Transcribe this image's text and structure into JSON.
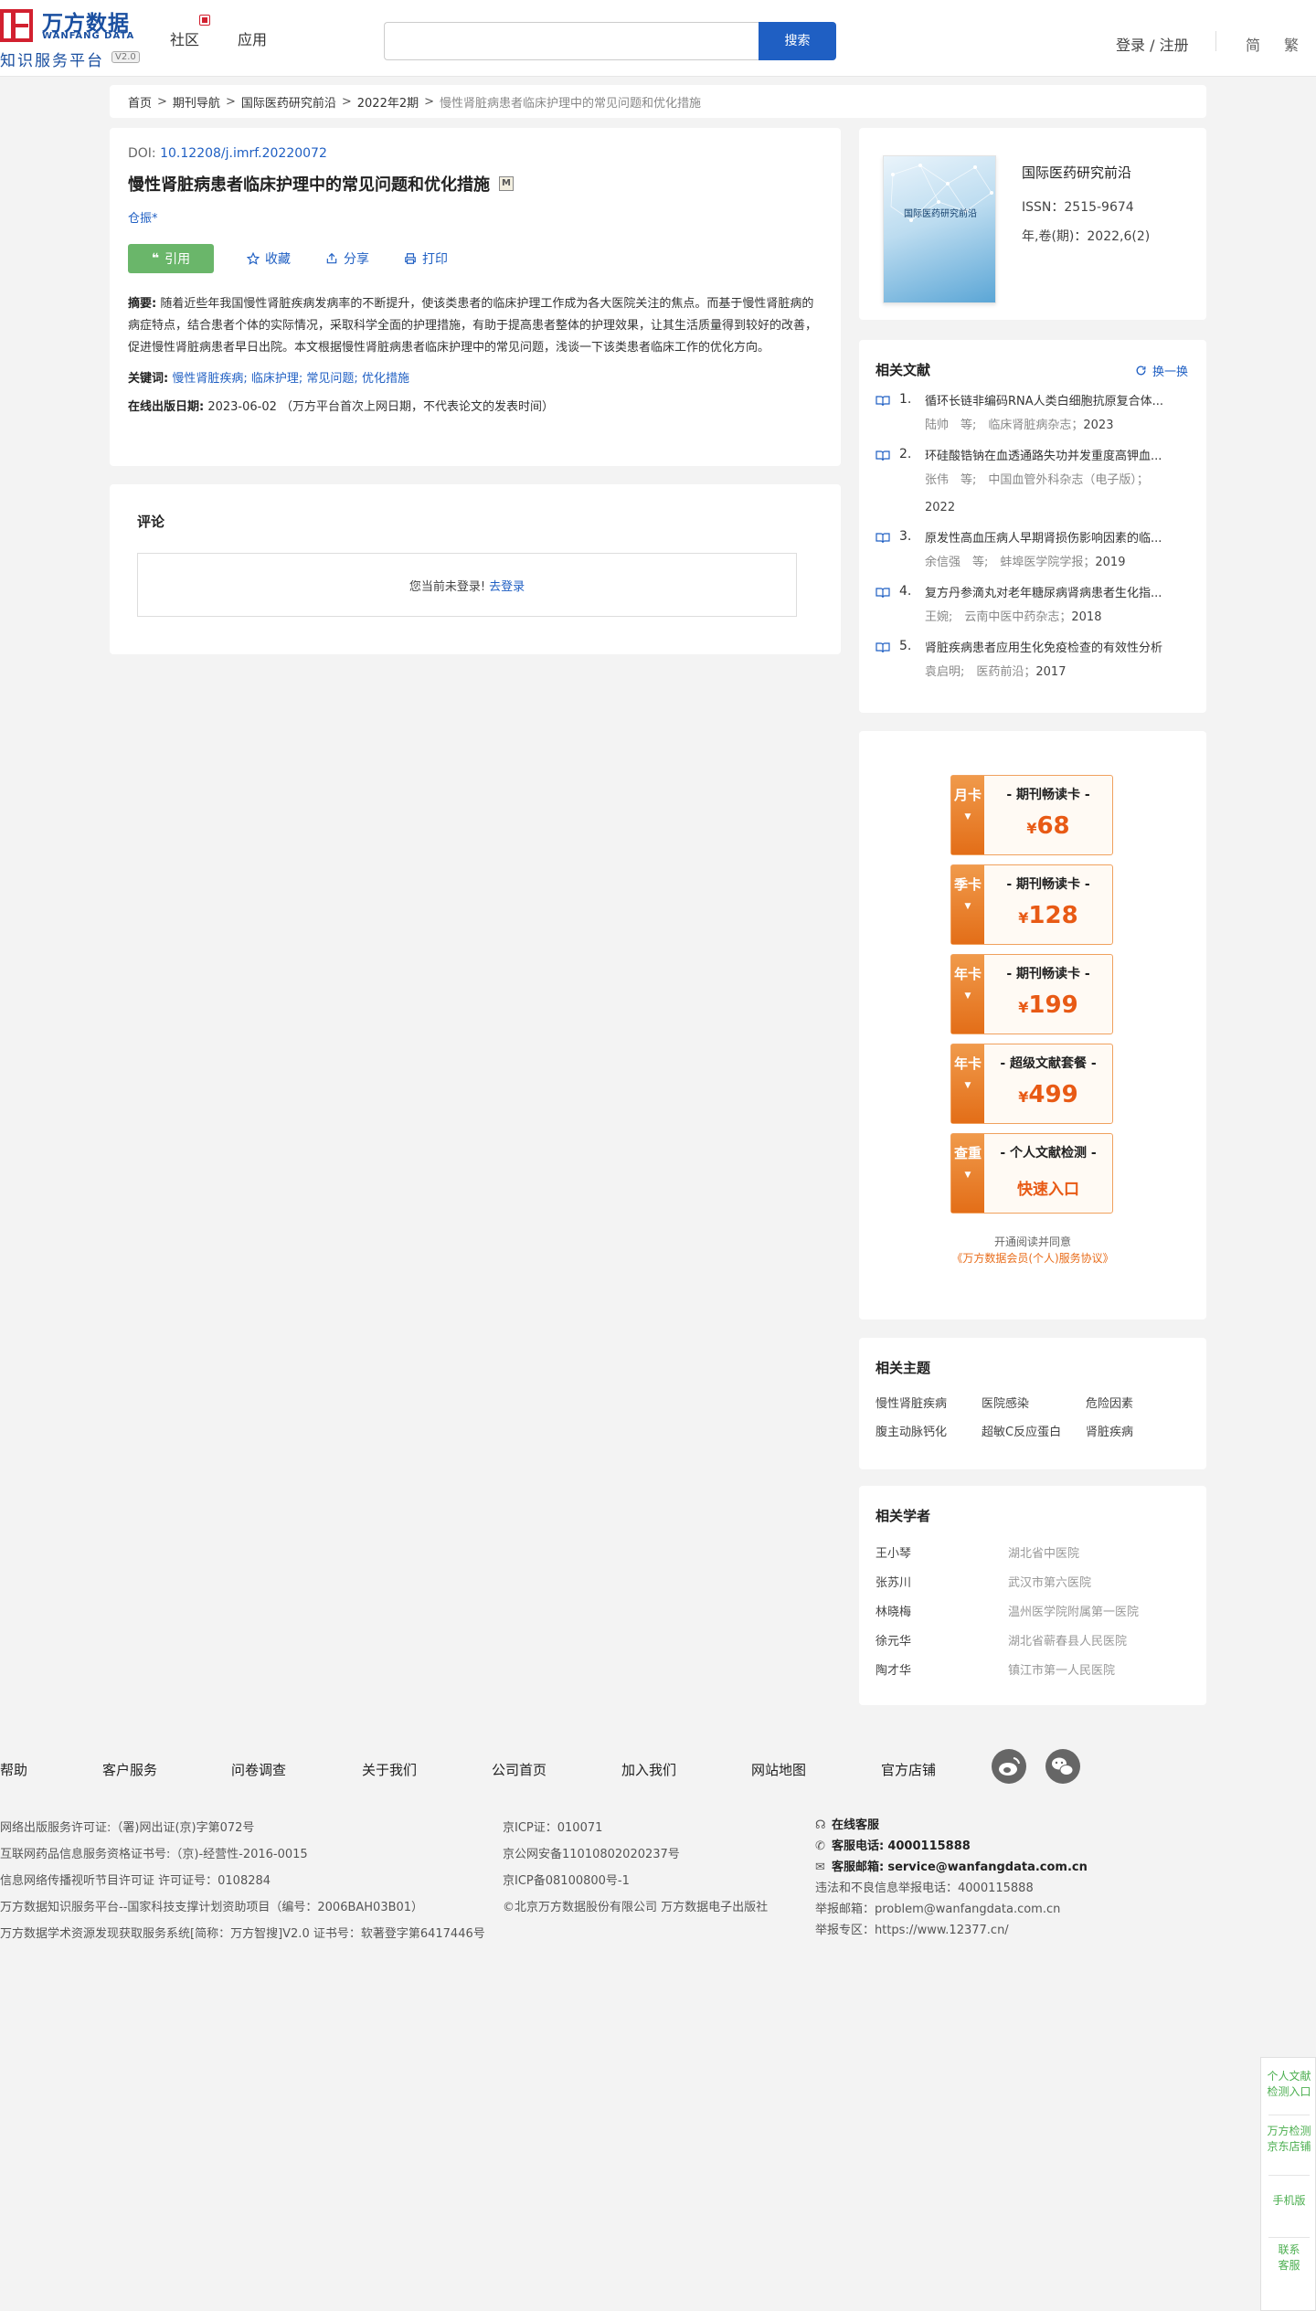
{
  "header": {
    "logo_cn": "万方数据",
    "logo_en": "WANFANG DATA",
    "logo_sub": "知识服务平台",
    "logo_version": "V2.0",
    "nav": [
      "社区",
      "应用"
    ],
    "search_button": "搜索",
    "search_placeholder": "",
    "login": "登录 / 注册",
    "lang_simplified": "简",
    "lang_traditional": "繁"
  },
  "breadcrumb": [
    "首页",
    "期刊导航",
    "国际医药研究前沿",
    "2022年2期",
    "慢性肾脏病患者临床护理中的常见问题和优化措施"
  ],
  "article": {
    "doi_label": "DOI: ",
    "doi": "10.12208/j.imrf.20220072",
    "title": "慢性肾脏病患者临床护理中的常见问题和优化措施",
    "badge": "M",
    "author": "仓振*",
    "actions": {
      "cite": "引用",
      "favorite": "收藏",
      "share": "分享",
      "print": "打印"
    },
    "abstract_label": "摘要:",
    "abstract": "随着近些年我国慢性肾脏疾病发病率的不断提升，使该类患者的临床护理工作成为各大医院关注的焦点。而基于慢性肾脏病的病症特点，结合患者个体的实际情况，采取科学全面的护理措施，有助于提高患者整体的护理效果，让其生活质量得到较好的改善，促进慢性肾脏病患者早日出院。本文根据慢性肾脏病患者临床护理中的常见问题，浅谈一下该类患者临床工作的优化方向。",
    "keywords_label": "关键词:",
    "keywords": [
      "慢性肾脏疾病",
      "临床护理",
      "常见问题",
      "优化措施"
    ],
    "pubdate_label": "在线出版日期:",
    "pubdate": "2023-06-02",
    "pubdate_note": "（万方平台首次上网日期，不代表论文的发表时间）"
  },
  "comments": {
    "title": "评论",
    "message": "您当前未登录!",
    "login_link": "去登录"
  },
  "journal": {
    "cover_title": "国际医药研究前沿",
    "name": "国际医药研究前沿",
    "issn": "ISSN：2515-9674",
    "year_issue": "年,卷(期)：2022,6(2)"
  },
  "related_docs": {
    "title": "相关文献",
    "refresh": "换一换",
    "items": [
      {
        "num": "1.",
        "title": "循环长链非编码RNA人类白细胞抗原复合体...",
        "meta": "陆帅　等;　临床肾脏病杂志；",
        "year": "2023"
      },
      {
        "num": "2.",
        "title": "环硅酸锆钠在血透通路失功并发重度高钾血...",
        "meta": "张伟　等;　中国血管外科杂志（电子版）；",
        "year": "2022"
      },
      {
        "num": "3.",
        "title": "原发性高血压病人早期肾损伤影响因素的临...",
        "meta": "余信强　等;　蚌埠医学院学报；",
        "year": "2019"
      },
      {
        "num": "4.",
        "title": "复方丹参滴丸对老年糖尿病肾病患者生化指...",
        "meta": "王婉;　云南中医中药杂志；",
        "year": "2018"
      },
      {
        "num": "5.",
        "title": "肾脏疾病患者应用生化免疫检查的有效性分析",
        "meta": "袁启明;　医药前沿；",
        "year": "2017"
      }
    ]
  },
  "promo": {
    "cards": [
      {
        "side": "月卡",
        "title": "- 期刊畅读卡 -",
        "yen": "¥",
        "price": "68"
      },
      {
        "side": "季卡",
        "title": "- 期刊畅读卡 -",
        "yen": "¥",
        "price": "128"
      },
      {
        "side": "年卡",
        "title": "- 期刊畅读卡 -",
        "yen": "¥",
        "price": "199"
      },
      {
        "side": "年卡",
        "title": "- 超级文献套餐 -",
        "yen": "¥",
        "price": "499"
      },
      {
        "side": "查重",
        "title": "- 个人文献检测 -",
        "quick": "快速入口"
      }
    ],
    "arrow": "▼",
    "note": "开通阅读并同意",
    "agreement": "《万方数据会员(个人)服务协议》"
  },
  "topics": {
    "title": "相关主题",
    "items": [
      "慢性肾脏疾病",
      "医院感染",
      "危险因素",
      "腹主动脉钙化",
      "超敏C反应蛋白",
      "肾脏疾病"
    ]
  },
  "scholars": {
    "title": "相关学者",
    "items": [
      {
        "name": "王小琴",
        "org": "湖北省中医院"
      },
      {
        "name": "张苏川",
        "org": "武汉市第六医院"
      },
      {
        "name": "林晓梅",
        "org": "温州医学院附属第一医院"
      },
      {
        "name": "徐元华",
        "org": "湖北省蕲春县人民医院"
      },
      {
        "name": "陶才华",
        "org": "镇江市第一人民医院"
      }
    ]
  },
  "footer": {
    "nav": [
      "帮助",
      "客户服务",
      "问卷调查",
      "关于我们",
      "公司首页",
      "加入我们",
      "网站地图",
      "官方店铺"
    ],
    "col1": [
      "网络出版服务许可证:（署)网出证(京)字第072号",
      "互联网药品信息服务资格证书号:（京)-经营性-2016-0015",
      "信息网络传播视听节目许可证 许可证号：0108284",
      "万方数据知识服务平台--国家科技支撑计划资助项目（编号：2006BAH03B01）",
      "万方数据学术资源发现获取服务系统[简称：万方智搜]V2.0 证书号：软著登字第6417446号"
    ],
    "col2": [
      "京ICP证：010071",
      "京公网安备11010802020237号",
      "京ICP备08100800号-1",
      "©北京万方数据股份有限公司 万方数据电子出版社"
    ],
    "online_service": "在线客服",
    "phone_label": "客服电话:",
    "phone": "4000115888",
    "email_label": "客服邮箱:",
    "email": "service@wanfangdata.com.cn",
    "report_phone": "违法和不良信息举报电话：4000115888",
    "report_email": "举报邮箱：problem@wanfangdata.com.cn",
    "report_zone": "举报专区：https://www.12377.cn/"
  },
  "side_widgets": {
    "w1": [
      "个人文献",
      "检测入口"
    ],
    "w2": [
      "万方检测",
      "京东店铺"
    ],
    "w3": "手机版",
    "w4": [
      "联系",
      "客服"
    ]
  }
}
